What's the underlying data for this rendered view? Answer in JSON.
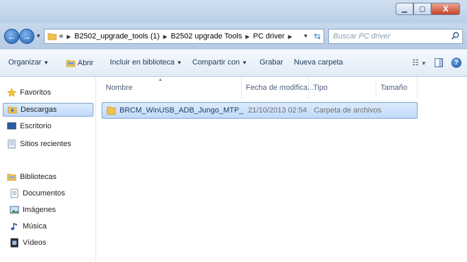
{
  "window": {
    "min_icon": "minimize-icon",
    "max_icon": "maximize-icon",
    "close_icon": "close-icon"
  },
  "address": {
    "overflow": "«",
    "crumbs": [
      "B2502_upgrade_tools (1)",
      "B2502 upgrade Tools",
      "PC driver"
    ]
  },
  "search": {
    "placeholder": "Buscar PC driver"
  },
  "toolbar": {
    "organize": "Organizar",
    "open": "Abrir",
    "include_library": "Incluir en biblioteca",
    "share": "Compartir con",
    "burn": "Grabar",
    "new_folder": "Nueva carpeta"
  },
  "sidebar": {
    "favorites": {
      "label": "Favoritos",
      "items": [
        "Descargas",
        "Escritorio",
        "Sitios recientes"
      ]
    },
    "libraries": {
      "label": "Bibliotecas",
      "items": [
        "Documentos",
        "Imágenes",
        "Música",
        "Vídeos"
      ]
    },
    "selected": "Descargas"
  },
  "columns": [
    "Nombre",
    "Fecha de modifica...",
    "Tipo",
    "Tamaño"
  ],
  "files": [
    {
      "name": "BRCM_WinUSB_ADB_Jungo_MTP_RNDIS...",
      "date": "21/10/2013 02:54 ...",
      "type": "Carpeta de archivos",
      "size": ""
    }
  ],
  "colors": {
    "accent": "#c1dbfc",
    "title_bar": "#b9cfe6",
    "folder": "#f2c24f"
  }
}
